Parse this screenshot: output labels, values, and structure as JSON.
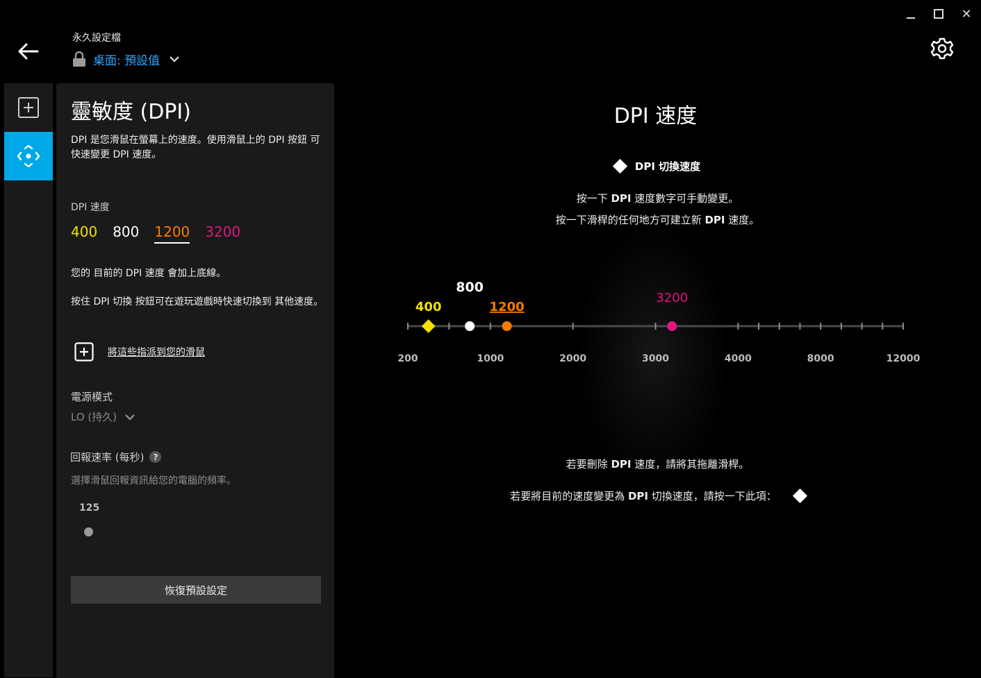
{
  "window": {
    "minimize": "—",
    "maximize": "☐",
    "close": "✕"
  },
  "header": {
    "profile_label": "永久設定檔",
    "profile_name": "桌面: 預設值"
  },
  "panel": {
    "title": "靈敏度 (DPI)",
    "description": "DPI 是您滑鼠在螢幕上的速度。使用滑鼠上的 DPI 按鈕 可快速變更 DPI 速度。",
    "dpi_label": "DPI 速度",
    "dpi_values": [
      {
        "label": "400",
        "color": "#f5e000"
      },
      {
        "label": "800",
        "color": "#ffffff"
      },
      {
        "label": "1200",
        "color": "#ff7a00"
      },
      {
        "label": "3200",
        "color": "#e0177e"
      }
    ],
    "current_note": "您的 目前的 DPI 速度 會加上底線。",
    "shift_note": "按住 DPI 切換 按鈕可在遊玩遊戲時快速切換到 其他速度。",
    "assign_label": "將這些指派到您的滑鼠",
    "power_label": "電源模式",
    "power_value": "LO (持久)",
    "report_title": "回報速率 (每秒)",
    "report_help": "?",
    "report_desc": "選擇滑鼠回報資訊給您的電腦的頻率。",
    "report_value": "125",
    "reset_label": "恢復預設設定"
  },
  "main": {
    "title": "DPI 速度",
    "shift_legend": "DPI 切換速度",
    "line1_pre": "按一下",
    "line1_bold": "DPI",
    "line1_post": "速度數字可手動變更。",
    "line2_pre": "按一下滑桿的任何地方可建立新",
    "line2_bold": "DPI",
    "line2_post": "速度。",
    "delete_pre": "若要刪除",
    "delete_bold": "DPI",
    "delete_post": "速度，請將其拖離滑桿。",
    "setshift_pre": "若要將目前的速度變更為",
    "setshift_bold": "DPI",
    "setshift_post": "切換速度，請按一下此項："
  },
  "slider": {
    "axis_labels": [
      "200",
      "1000",
      "2000",
      "3000",
      "4000",
      "8000",
      "12000"
    ],
    "points": [
      {
        "label": "400",
        "color": "#f5e000",
        "shape": "diamond",
        "shift": true
      },
      {
        "label": "800",
        "color": "#ffffff",
        "shape": "circle"
      },
      {
        "label": "1200",
        "color": "#ff7a00",
        "shape": "circle",
        "current": true
      },
      {
        "label": "3200",
        "color": "#e0177e",
        "shape": "circle"
      }
    ]
  },
  "icons": {
    "back": "arrow-left-icon",
    "lock": "lock-icon",
    "chevron": "chevron-down-icon",
    "gear": "gear-icon",
    "add": "plus-square-icon",
    "move": "move-arrows-icon"
  },
  "colors": {
    "accent": "#00a8e8",
    "link": "#2fa6ff",
    "panel": "#1a1a1a"
  }
}
